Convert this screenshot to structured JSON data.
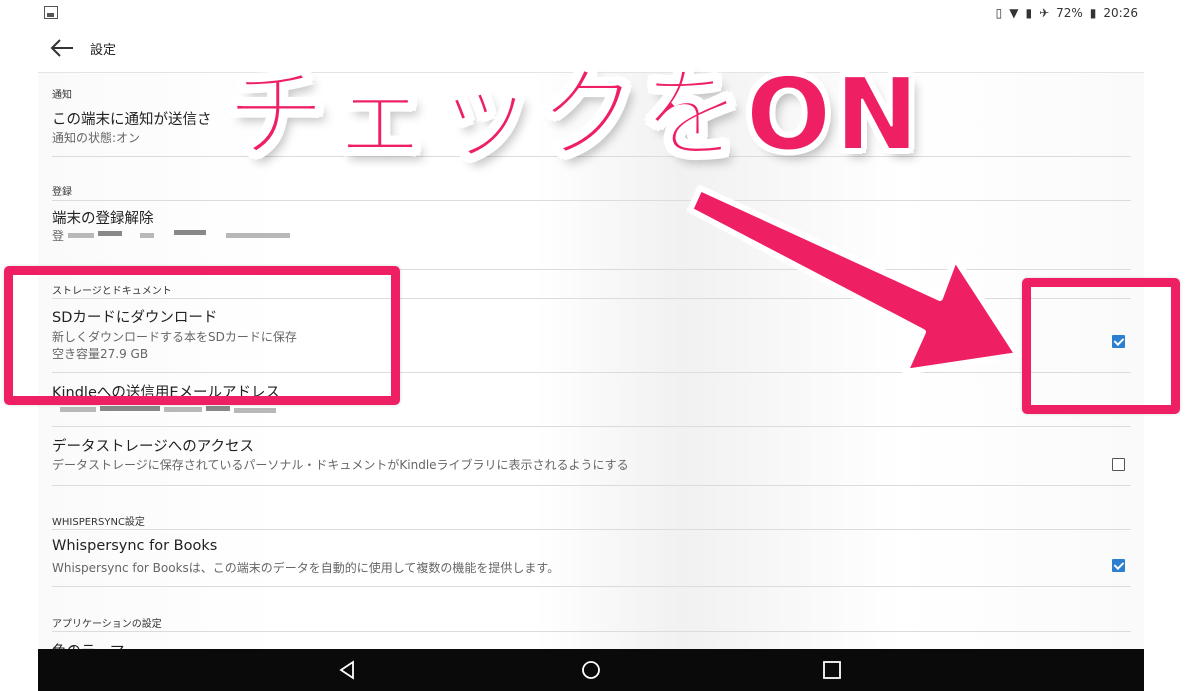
{
  "status_bar": {
    "battery": "72%",
    "time": "20:26",
    "icons": [
      "vibrate-icon",
      "wifi-icon",
      "battery-saver-icon",
      "airplane-icon",
      "battery-icon"
    ]
  },
  "app_bar": {
    "title": "設定"
  },
  "sections": {
    "notifications": {
      "header": "通知",
      "row_title": "この端末に通知が送信さ",
      "row_sub": "通知の状態:オン"
    },
    "registration": {
      "header": "登録",
      "row_title": "端末の登録解除",
      "row_sub": "登"
    },
    "storage": {
      "header": "ストレージとドキュメント",
      "sd_title": "SDカードにダウンロード",
      "sd_sub1": "新しくダウンロードする本をSDカードに保存",
      "sd_sub2": "空き容量27.9 GB",
      "sd_checked": true,
      "email_title": "Kindleへの送信用Eメールアドレス",
      "access_title": "データストレージへのアクセス",
      "access_sub": "データストレージに保存されているパーソナル・ドキュメントがKindleライブラリに表示されるようにする",
      "access_checked": false
    },
    "whispersync": {
      "header": "WHISPERSYNC設定",
      "row_title": "Whispersync for Books",
      "row_sub": "Whispersync for Booksは、この端末のデータを自動的に使用して複数の機能を提供します。",
      "checked": true
    },
    "app_settings": {
      "header": "アプリケーションの設定",
      "row_title": "色のテーマ"
    }
  },
  "annotation": {
    "text": "チェックをON",
    "color": "#ee1f63"
  },
  "colors": {
    "checkbox_checked": "#2a7fd0",
    "nav_bar": "#0a0a0a"
  }
}
